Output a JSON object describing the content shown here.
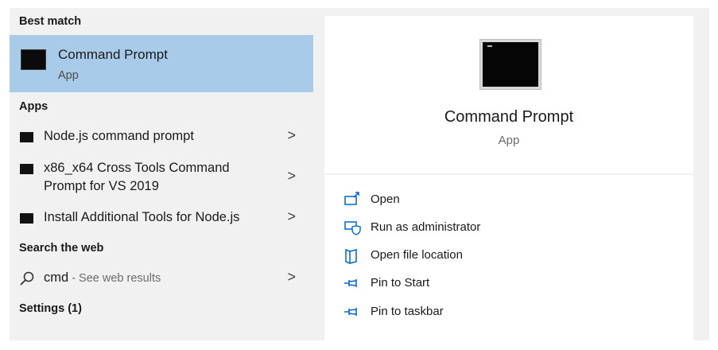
{
  "best_match": {
    "header": "Best match",
    "title": "Command Prompt",
    "subtitle": "App"
  },
  "apps": {
    "header": "Apps",
    "items": [
      {
        "label": "Node.js command prompt"
      },
      {
        "label": "x86_x64 Cross Tools Command Prompt for VS 2019"
      },
      {
        "label": "Install Additional Tools for Node.js"
      }
    ]
  },
  "search_web": {
    "header": "Search the web",
    "query": "cmd",
    "suffix": " - See web results"
  },
  "settings": {
    "header": "Settings (1)"
  },
  "details": {
    "title": "Command Prompt",
    "subtitle": "App",
    "actions": [
      {
        "label": "Open",
        "icon": "open-icon"
      },
      {
        "label": "Run as administrator",
        "icon": "shield-icon"
      },
      {
        "label": "Open file location",
        "icon": "file-location-icon"
      },
      {
        "label": "Pin to Start",
        "icon": "pin-icon"
      },
      {
        "label": "Pin to taskbar",
        "icon": "pin-icon"
      }
    ]
  },
  "colors": {
    "accent": "#0067c0",
    "selected_bg": "#a9cbea",
    "panel_bg": "#f1f1f1"
  }
}
